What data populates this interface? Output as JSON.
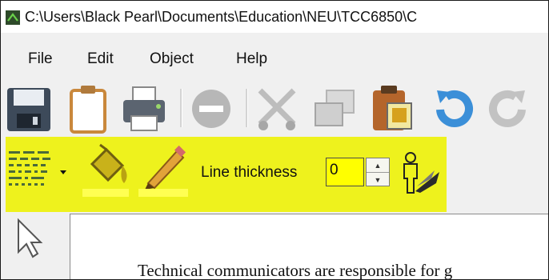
{
  "window": {
    "title": "C:\\Users\\Black Pearl\\Documents\\Education\\NEU\\TCC6850\\C"
  },
  "menu": {
    "file": "File",
    "edit": "Edit",
    "object": "Object",
    "help": "Help"
  },
  "toolbar": {
    "buttons": [
      "save-icon",
      "new-page-icon",
      "print-icon",
      "delete-icon",
      "cut-icon",
      "copy-icon",
      "paste-icon",
      "undo-icon",
      "redo-icon"
    ]
  },
  "drawbar": {
    "line_thickness_label": "Line thickness",
    "line_thickness_value": "0",
    "highlight_color": "#eef21d"
  },
  "document": {
    "text": "Technical communicators are responsible for g"
  }
}
